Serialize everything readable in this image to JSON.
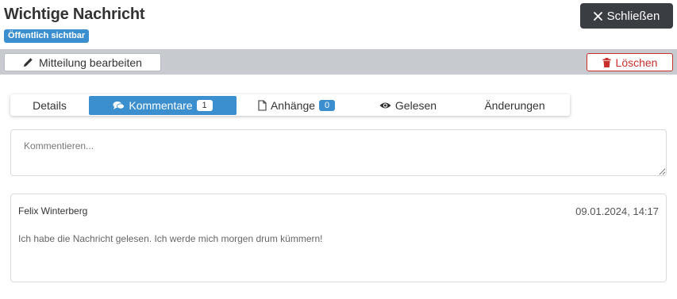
{
  "header": {
    "title": "Wichtige Nachricht",
    "visibility_badge": "Öffentlich sichtbar",
    "close_label": "Schließen",
    "close_icon": "times-icon"
  },
  "toolbar": {
    "edit_label": "Mitteilung bearbeiten",
    "edit_icon": "pencil-icon",
    "delete_label": "Löschen",
    "delete_icon": "trash-icon"
  },
  "tabs": [
    {
      "label": "Details",
      "icon": "",
      "count": "",
      "active": false
    },
    {
      "label": "Kommentare",
      "icon": "comments-icon",
      "count": "1",
      "active": true
    },
    {
      "label": "Anhänge",
      "icon": "file-icon",
      "count": "0",
      "active": false
    },
    {
      "label": "Gelesen",
      "icon": "eye-icon",
      "count": "",
      "active": false
    },
    {
      "label": "Änderungen",
      "icon": "",
      "count": "",
      "active": false
    }
  ],
  "comment_input": {
    "placeholder": "Kommentieren..."
  },
  "comments": [
    {
      "author": "Felix Winterberg",
      "date": "09.01.2024, 14:17",
      "text": "Ich habe die Nachricht gelesen. Ich werde mich morgen drum kümmern!"
    }
  ],
  "colors": {
    "primary": "#3b8fcf",
    "danger": "#c9302c",
    "dark_button": "#3a3d42",
    "toolbar_bg": "#c7cacf"
  }
}
